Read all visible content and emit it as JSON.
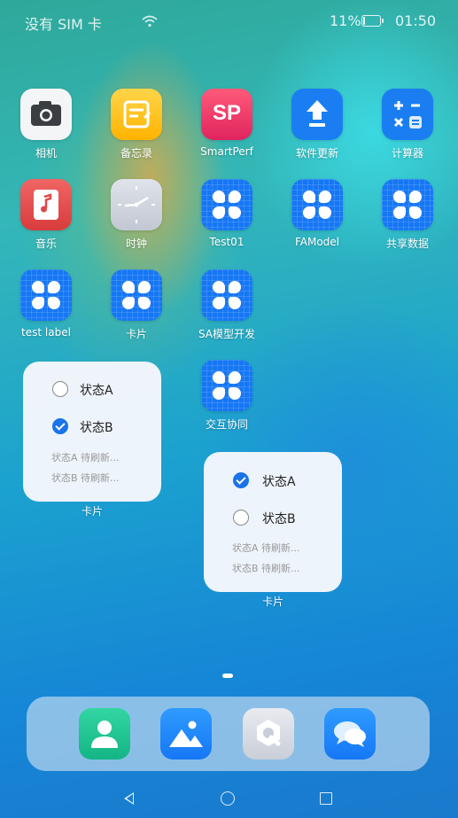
{
  "status_bar": {
    "carrier": "没有 SIM 卡",
    "battery": "11%",
    "time": "01:50"
  },
  "apps": [
    {
      "label": "相机",
      "icon": "camera-icon"
    },
    {
      "label": "备忘录",
      "icon": "notes-icon"
    },
    {
      "label": "SmartPerf",
      "icon": "smartperf-icon",
      "icon_text": "SP"
    },
    {
      "label": "软件更新",
      "icon": "software-update-icon"
    },
    {
      "label": "计算器",
      "icon": "calculator-icon"
    },
    {
      "label": "音乐",
      "icon": "music-icon"
    },
    {
      "label": "时钟",
      "icon": "clock-icon"
    },
    {
      "label": "Test01",
      "icon": "clover-icon"
    },
    {
      "label": "FAModel",
      "icon": "clover-icon"
    },
    {
      "label": "共享数据",
      "icon": "clover-icon"
    },
    {
      "label": "test label",
      "icon": "clover-icon"
    },
    {
      "label": "卡片",
      "icon": "clover-icon"
    },
    {
      "label": "SA模型开发",
      "icon": "clover-icon"
    },
    {
      "label": "交互协同",
      "icon": "clover-icon"
    }
  ],
  "cards": [
    {
      "label": "卡片",
      "option_a": "状态A",
      "option_b": "状态B",
      "selected": "B",
      "status_a": "状态A  待刷新...",
      "status_b": "状态B  待刷新..."
    },
    {
      "label": "卡片",
      "option_a": "状态A",
      "option_b": "状态B",
      "selected": "A",
      "status_a": "状态A  待刷新...",
      "status_b": "状态B  待刷新..."
    }
  ],
  "dock": [
    {
      "icon": "contacts-icon"
    },
    {
      "icon": "gallery-icon"
    },
    {
      "icon": "app-store-icon"
    },
    {
      "icon": "messages-icon"
    }
  ],
  "colors": {
    "accent": "#1a73e8",
    "app_blue": "#1677f5"
  }
}
